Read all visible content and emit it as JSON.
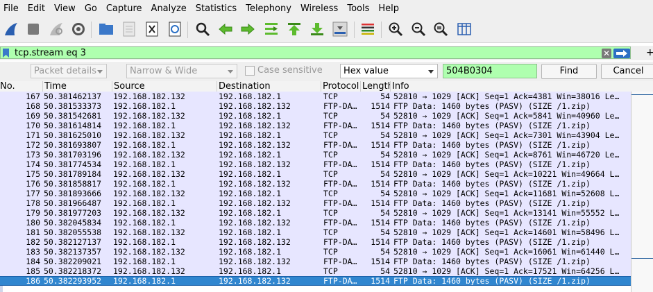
{
  "menu": [
    "File",
    "Edit",
    "View",
    "Go",
    "Capture",
    "Analyze",
    "Statistics",
    "Telephony",
    "Wireless",
    "Tools",
    "Help"
  ],
  "filter": {
    "value": "tcp.stream eq 3",
    "plus_label": "+"
  },
  "find": {
    "search_in": "Packet details",
    "char_width": "Narrow & Wide",
    "case_sensitive_label": "Case sensitive",
    "search_type": "Hex value",
    "search_value": "504B0304",
    "find_label": "Find",
    "cancel_label": "Cancel"
  },
  "columns": [
    "No.",
    "Time",
    "Source",
    "Destination",
    "Protocol",
    "Length",
    "Info"
  ],
  "packets": [
    {
      "no": "167",
      "time": "50.381462137",
      "src": "192.168.182.132",
      "dst": "192.168.182.1",
      "proto": "TCP",
      "len": "54",
      "info": "52810 → 1029 [ACK] Seq=1 Ack=4381 Win=38016 Le…"
    },
    {
      "no": "168",
      "time": "50.381533373",
      "src": "192.168.182.1",
      "dst": "192.168.182.132",
      "proto": "FTP-DA…",
      "len": "1514",
      "info": "FTP Data: 1460 bytes (PASV) (SIZE /1.zip)"
    },
    {
      "no": "169",
      "time": "50.381542681",
      "src": "192.168.182.132",
      "dst": "192.168.182.1",
      "proto": "TCP",
      "len": "54",
      "info": "52810 → 1029 [ACK] Seq=1 Ack=5841 Win=40960 Le…"
    },
    {
      "no": "170",
      "time": "50.381614814",
      "src": "192.168.182.1",
      "dst": "192.168.182.132",
      "proto": "FTP-DA…",
      "len": "1514",
      "info": "FTP Data: 1460 bytes (PASV) (SIZE /1.zip)"
    },
    {
      "no": "171",
      "time": "50.381625010",
      "src": "192.168.182.132",
      "dst": "192.168.182.1",
      "proto": "TCP",
      "len": "54",
      "info": "52810 → 1029 [ACK] Seq=1 Ack=7301 Win=43904 Le…"
    },
    {
      "no": "172",
      "time": "50.381693807",
      "src": "192.168.182.1",
      "dst": "192.168.182.132",
      "proto": "FTP-DA…",
      "len": "1514",
      "info": "FTP Data: 1460 bytes (PASV) (SIZE /1.zip)"
    },
    {
      "no": "173",
      "time": "50.381703196",
      "src": "192.168.182.132",
      "dst": "192.168.182.1",
      "proto": "TCP",
      "len": "54",
      "info": "52810 → 1029 [ACK] Seq=1 Ack=8761 Win=46720 Le…"
    },
    {
      "no": "174",
      "time": "50.381774534",
      "src": "192.168.182.1",
      "dst": "192.168.182.132",
      "proto": "FTP-DA…",
      "len": "1514",
      "info": "FTP Data: 1460 bytes (PASV) (SIZE /1.zip)"
    },
    {
      "no": "175",
      "time": "50.381789184",
      "src": "192.168.182.132",
      "dst": "192.168.182.1",
      "proto": "TCP",
      "len": "54",
      "info": "52810 → 1029 [ACK] Seq=1 Ack=10221 Win=49664 L…"
    },
    {
      "no": "176",
      "time": "50.381858817",
      "src": "192.168.182.1",
      "dst": "192.168.182.132",
      "proto": "FTP-DA…",
      "len": "1514",
      "info": "FTP Data: 1460 bytes (PASV) (SIZE /1.zip)"
    },
    {
      "no": "177",
      "time": "50.381893666",
      "src": "192.168.182.132",
      "dst": "192.168.182.1",
      "proto": "TCP",
      "len": "54",
      "info": "52810 → 1029 [ACK] Seq=1 Ack=11681 Win=52608 L…"
    },
    {
      "no": "178",
      "time": "50.381966487",
      "src": "192.168.182.1",
      "dst": "192.168.182.132",
      "proto": "FTP-DA…",
      "len": "1514",
      "info": "FTP Data: 1460 bytes (PASV) (SIZE /1.zip)"
    },
    {
      "no": "179",
      "time": "50.381977203",
      "src": "192.168.182.132",
      "dst": "192.168.182.1",
      "proto": "TCP",
      "len": "54",
      "info": "52810 → 1029 [ACK] Seq=1 Ack=13141 Win=55552 L…"
    },
    {
      "no": "180",
      "time": "50.382045834",
      "src": "192.168.182.1",
      "dst": "192.168.182.132",
      "proto": "FTP-DA…",
      "len": "1514",
      "info": "FTP Data: 1460 bytes (PASV) (SIZE /1.zip)"
    },
    {
      "no": "181",
      "time": "50.382055538",
      "src": "192.168.182.132",
      "dst": "192.168.182.1",
      "proto": "TCP",
      "len": "54",
      "info": "52810 → 1029 [ACK] Seq=1 Ack=14601 Win=58496 L…"
    },
    {
      "no": "182",
      "time": "50.382127137",
      "src": "192.168.182.1",
      "dst": "192.168.182.132",
      "proto": "FTP-DA…",
      "len": "1514",
      "info": "FTP Data: 1460 bytes (PASV) (SIZE /1.zip)"
    },
    {
      "no": "183",
      "time": "50.382137357",
      "src": "192.168.182.132",
      "dst": "192.168.182.1",
      "proto": "TCP",
      "len": "54",
      "info": "52810 → 1029 [ACK] Seq=1 Ack=16061 Win=61440 L…"
    },
    {
      "no": "184",
      "time": "50.382209021",
      "src": "192.168.182.1",
      "dst": "192.168.182.132",
      "proto": "FTP-DA…",
      "len": "1514",
      "info": "FTP Data: 1460 bytes (PASV) (SIZE /1.zip)"
    },
    {
      "no": "185",
      "time": "50.382218372",
      "src": "192.168.182.132",
      "dst": "192.168.182.1",
      "proto": "TCP",
      "len": "54",
      "info": "52810 → 1029 [ACK] Seq=1 Ack=17521 Win=64256 L…"
    },
    {
      "no": "186",
      "time": "50.382293952",
      "src": "192.168.182.1",
      "dst": "192.168.182.132",
      "proto": "FTP-DA…",
      "len": "1514",
      "info": "FTP Data: 1460 bytes (PASV) (SIZE /1.zip)",
      "selected": true
    }
  ],
  "colors": {
    "row_bg": "#e7e6ff",
    "selected_bg": "#3086cf",
    "filter_valid_bg": "#afffaf"
  }
}
